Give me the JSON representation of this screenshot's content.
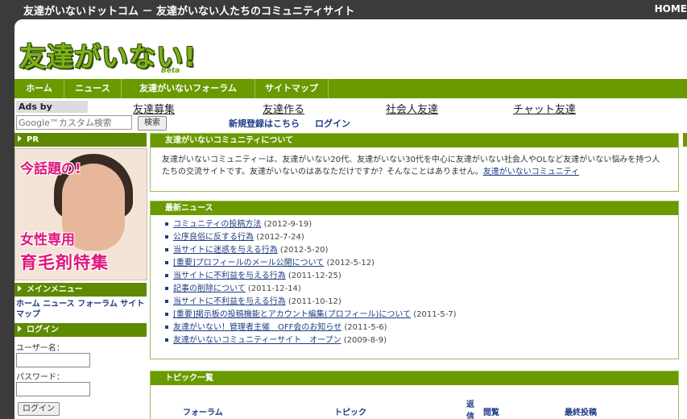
{
  "topbar": {
    "site_title": "友達がいないドットコム － 友達がいない人たちのコミュニティサイト",
    "home_link": "HOME"
  },
  "logo": {
    "text": "友達がいない!",
    "beta": "Beta"
  },
  "nav": {
    "items": [
      {
        "label": "ホーム"
      },
      {
        "label": "ニュース"
      },
      {
        "label": "友達がいないフォーラム"
      },
      {
        "label": "サイトマップ"
      }
    ]
  },
  "ads": {
    "label": "Ads by Google",
    "links": [
      "友達募集",
      "友達作る",
      "社会人友達",
      "チャット友達"
    ]
  },
  "search": {
    "placeholder": "Google™カスタム検索",
    "button": "検索"
  },
  "header_links": {
    "register": "新規登録はこちら",
    "login": "ログイン"
  },
  "sidebar": {
    "pr_title": "PR",
    "ad_banner": {
      "line1": "今話題の!",
      "line2": "女性専用",
      "line3": "育毛剤特集"
    },
    "main_menu_title": "メインメニュー",
    "menu_items": [
      "ホーム",
      "ニュース",
      "フォーラム",
      "サイトマップ"
    ],
    "login_title": "ログイン",
    "username_label": "ユーザー名：",
    "password_label": "パスワード：",
    "login_button": "ログイン"
  },
  "about": {
    "title": "友達がいないコミュニティについて",
    "text": "友達がいないコミュニティーは、友達がいない20代、友達がいない30代を中心に友達がいない社会人やOLなど友達がいない悩みを持つ人たちの交流サイトです。友達がいないのはあなただけですか？そんなことはありません。",
    "link": "友達がいないコミュニティ"
  },
  "news": {
    "title": "最新ニュース",
    "items": [
      {
        "title": "コミュニティの投稿方法",
        "date": "(2012-9-19)"
      },
      {
        "title": "公序良俗に反する行為",
        "date": "(2012-7-24)"
      },
      {
        "title": "当サイトに迷惑を与える行為",
        "date": "(2012-5-20)"
      },
      {
        "title": "[重要]プロフィールのメール公開について",
        "date": "(2012-5-12)"
      },
      {
        "title": "当サイトに不利益を与える行為",
        "date": "(2011-12-25)"
      },
      {
        "title": "記事の削除について",
        "date": "(2011-12-14)"
      },
      {
        "title": "当サイトに不利益を与える行為",
        "date": "(2011-10-12)"
      },
      {
        "title": "[重要]掲示板の投稿機能とアカウント編集(プロフィール)について",
        "date": "(2011-5-7)"
      },
      {
        "title": "友達がいない！管理者主催　OFF会のお知らせ",
        "date": "(2011-5-6)"
      },
      {
        "title": "友達がいないコミュニティーサイト　オープン",
        "date": "(2009-8-9)"
      }
    ]
  },
  "topics": {
    "title": "トピック一覧",
    "headers": [
      "フォーラム",
      "トピック",
      "返信",
      "閲覧",
      "最終投稿"
    ]
  }
}
